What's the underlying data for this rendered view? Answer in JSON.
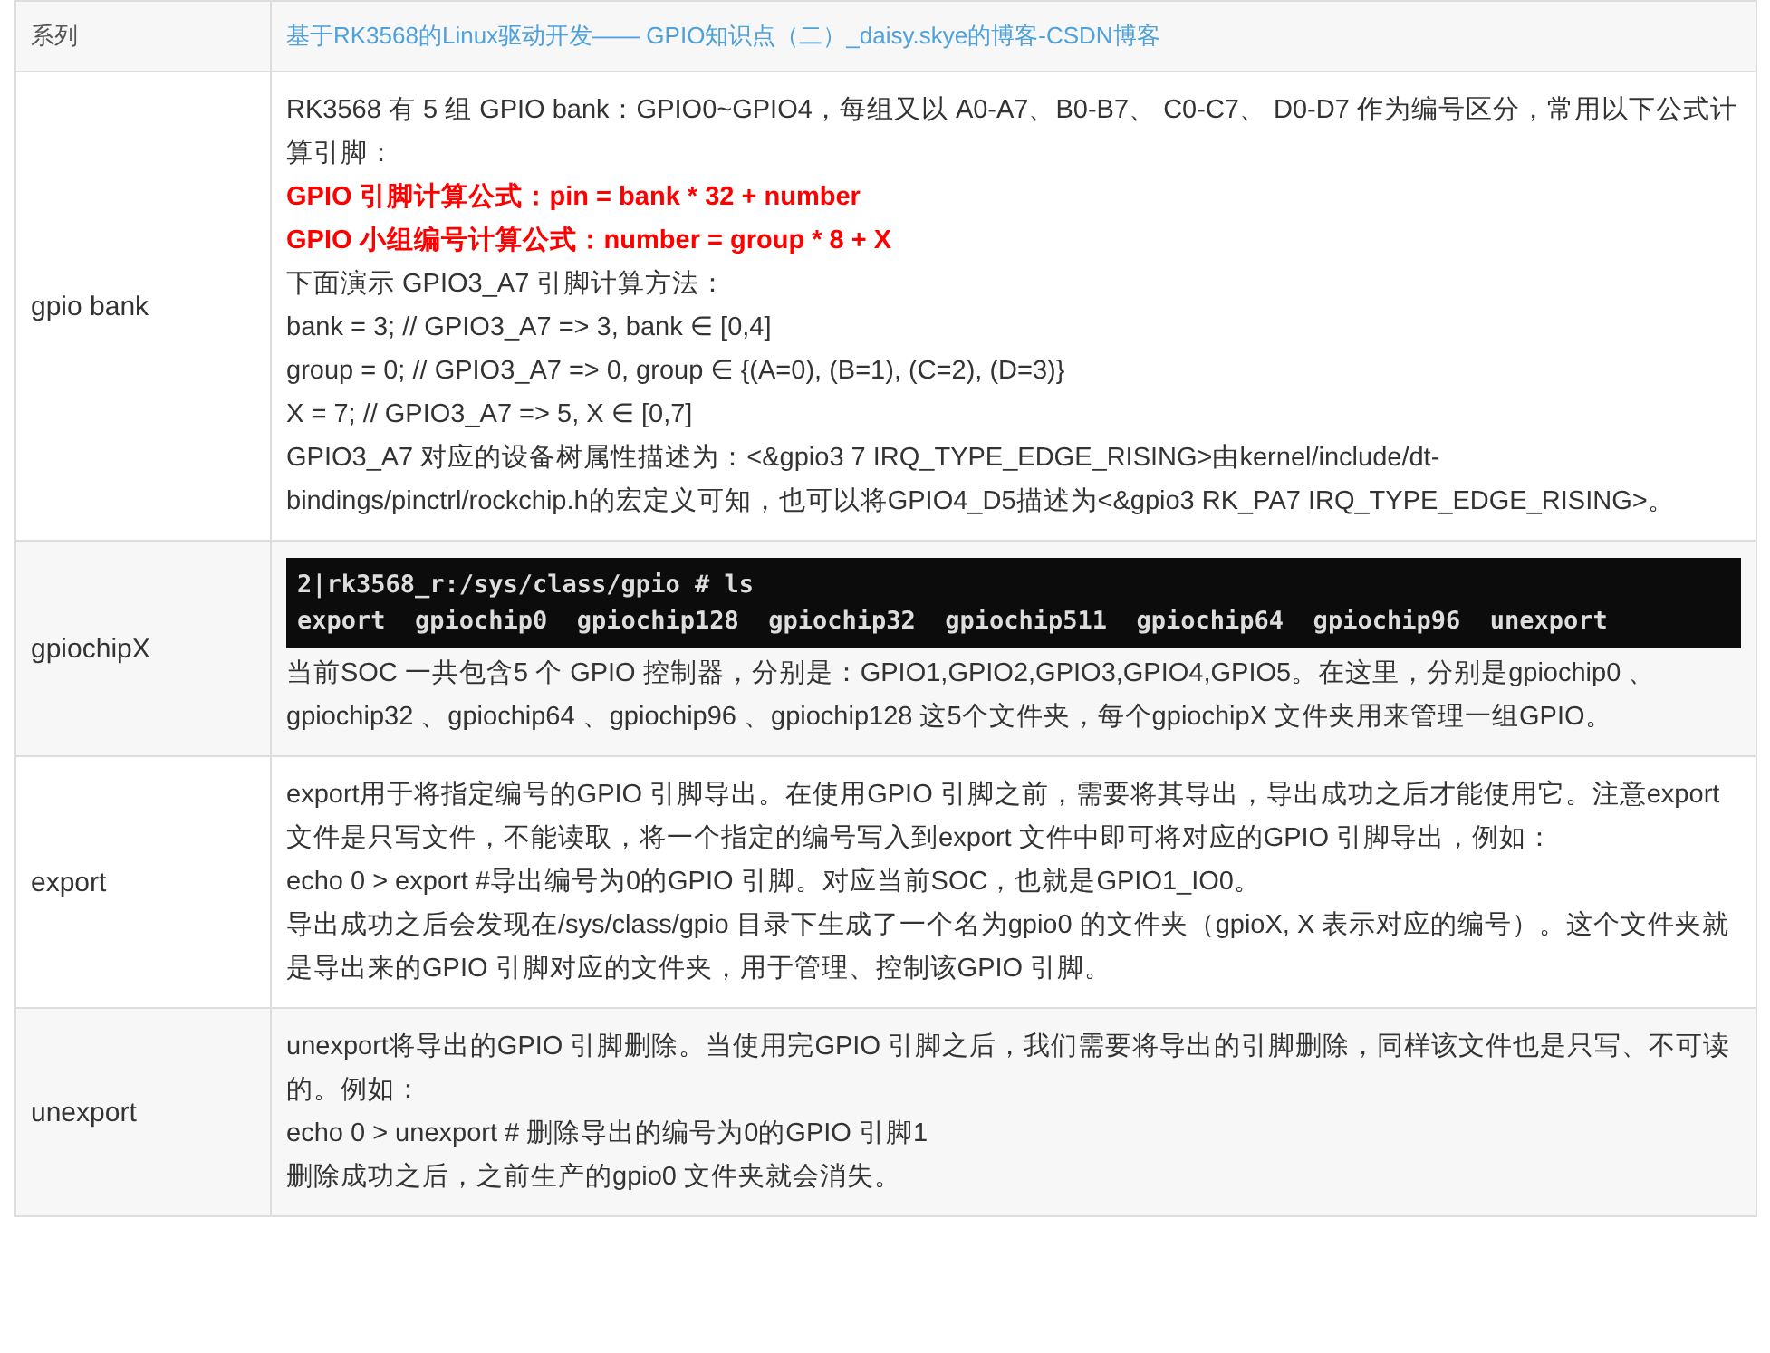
{
  "table": {
    "header": {
      "label": "系列",
      "link": "基于RK3568的Linux驱动开发—— GPIO知识点（二）_daisy.skye的博客-CSDN博客"
    },
    "rows": [
      {
        "label": "gpio bank",
        "blocks": [
          {
            "kind": "text",
            "text": "RK3568 有 5 组 GPIO bank：GPIO0~GPIO4，每组又以 A0-A7、B0-B7、 C0-C7、 D0-D7 作为编号区分，常用以下公式计算引脚："
          },
          {
            "kind": "formula",
            "text": "GPIO 引脚计算公式：pin = bank * 32 + number"
          },
          {
            "kind": "formula",
            "text": "GPIO 小组编号计算公式：number = group * 8 + X"
          },
          {
            "kind": "text",
            "text": "下面演示 GPIO3_A7 引脚计算方法："
          },
          {
            "kind": "text",
            "text": "bank = 3; // GPIO3_A7 => 3, bank ∈ [0,4]"
          },
          {
            "kind": "text",
            "text": "group = 0; // GPIO3_A7 => 0, group ∈ {(A=0), (B=1), (C=2), (D=3)}"
          },
          {
            "kind": "text",
            "text": "X = 7; // GPIO3_A7 => 5, X ∈ [0,7]"
          },
          {
            "kind": "text",
            "text": "GPIO3_A7 对应的设备树属性描述为：<&gpio3 7 IRQ_TYPE_EDGE_RISING>由kernel/include/dt-bindings/pinctrl/rockchip.h的宏定义可知，也可以将GPIO4_D5描述为<&gpio3 RK_PA7 IRQ_TYPE_EDGE_RISING>。"
          }
        ]
      },
      {
        "label": "gpiochipX",
        "blocks": [
          {
            "kind": "terminal",
            "lines": [
              "2|rk3568_r:/sys/class/gpio # ls",
              "export  gpiochip0  gpiochip128  gpiochip32  gpiochip511  gpiochip64  gpiochip96  unexport"
            ]
          },
          {
            "kind": "text",
            "text": "当前SOC 一共包含5 个 GPIO 控制器，分别是：GPIO1,GPIO2,GPIO3,GPIO4,GPIO5。在这里，分别是gpiochip0 、gpiochip32 、gpiochip64 、gpiochip96 、gpiochip128 这5个文件夹，每个gpiochipX 文件夹用来管理一组GPIO。"
          }
        ]
      },
      {
        "label": "export",
        "blocks": [
          {
            "kind": "text",
            "text": "export用于将指定编号的GPIO 引脚导出。在使用GPIO 引脚之前，需要将其导出，导出成功之后才能使用它。注意export 文件是只写文件，不能读取，将一个指定的编号写入到export 文件中即可将对应的GPIO 引脚导出，例如："
          },
          {
            "kind": "text",
            "text": "echo 0 > export #导出编号为0的GPIO 引脚。对应当前SOC，也就是GPIO1_IO0。"
          },
          {
            "kind": "text",
            "text": "导出成功之后会发现在/sys/class/gpio 目录下生成了一个名为gpio0 的文件夹（gpioX, X 表示对应的编号）。这个文件夹就是导出来的GPIO 引脚对应的文件夹，用于管理、控制该GPIO 引脚。"
          }
        ]
      },
      {
        "label": "unexport",
        "blocks": [
          {
            "kind": "text",
            "text": "unexport将导出的GPIO 引脚删除。当使用完GPIO 引脚之后，我们需要将导出的引脚删除，同样该文件也是只写、不可读的。例如："
          },
          {
            "kind": "text",
            "text": "echo 0 > unexport # 删除导出的编号为0的GPIO 引脚1"
          },
          {
            "kind": "text",
            "text": "删除成功之后，之前生产的gpio0 文件夹就会消失。"
          }
        ]
      }
    ]
  }
}
